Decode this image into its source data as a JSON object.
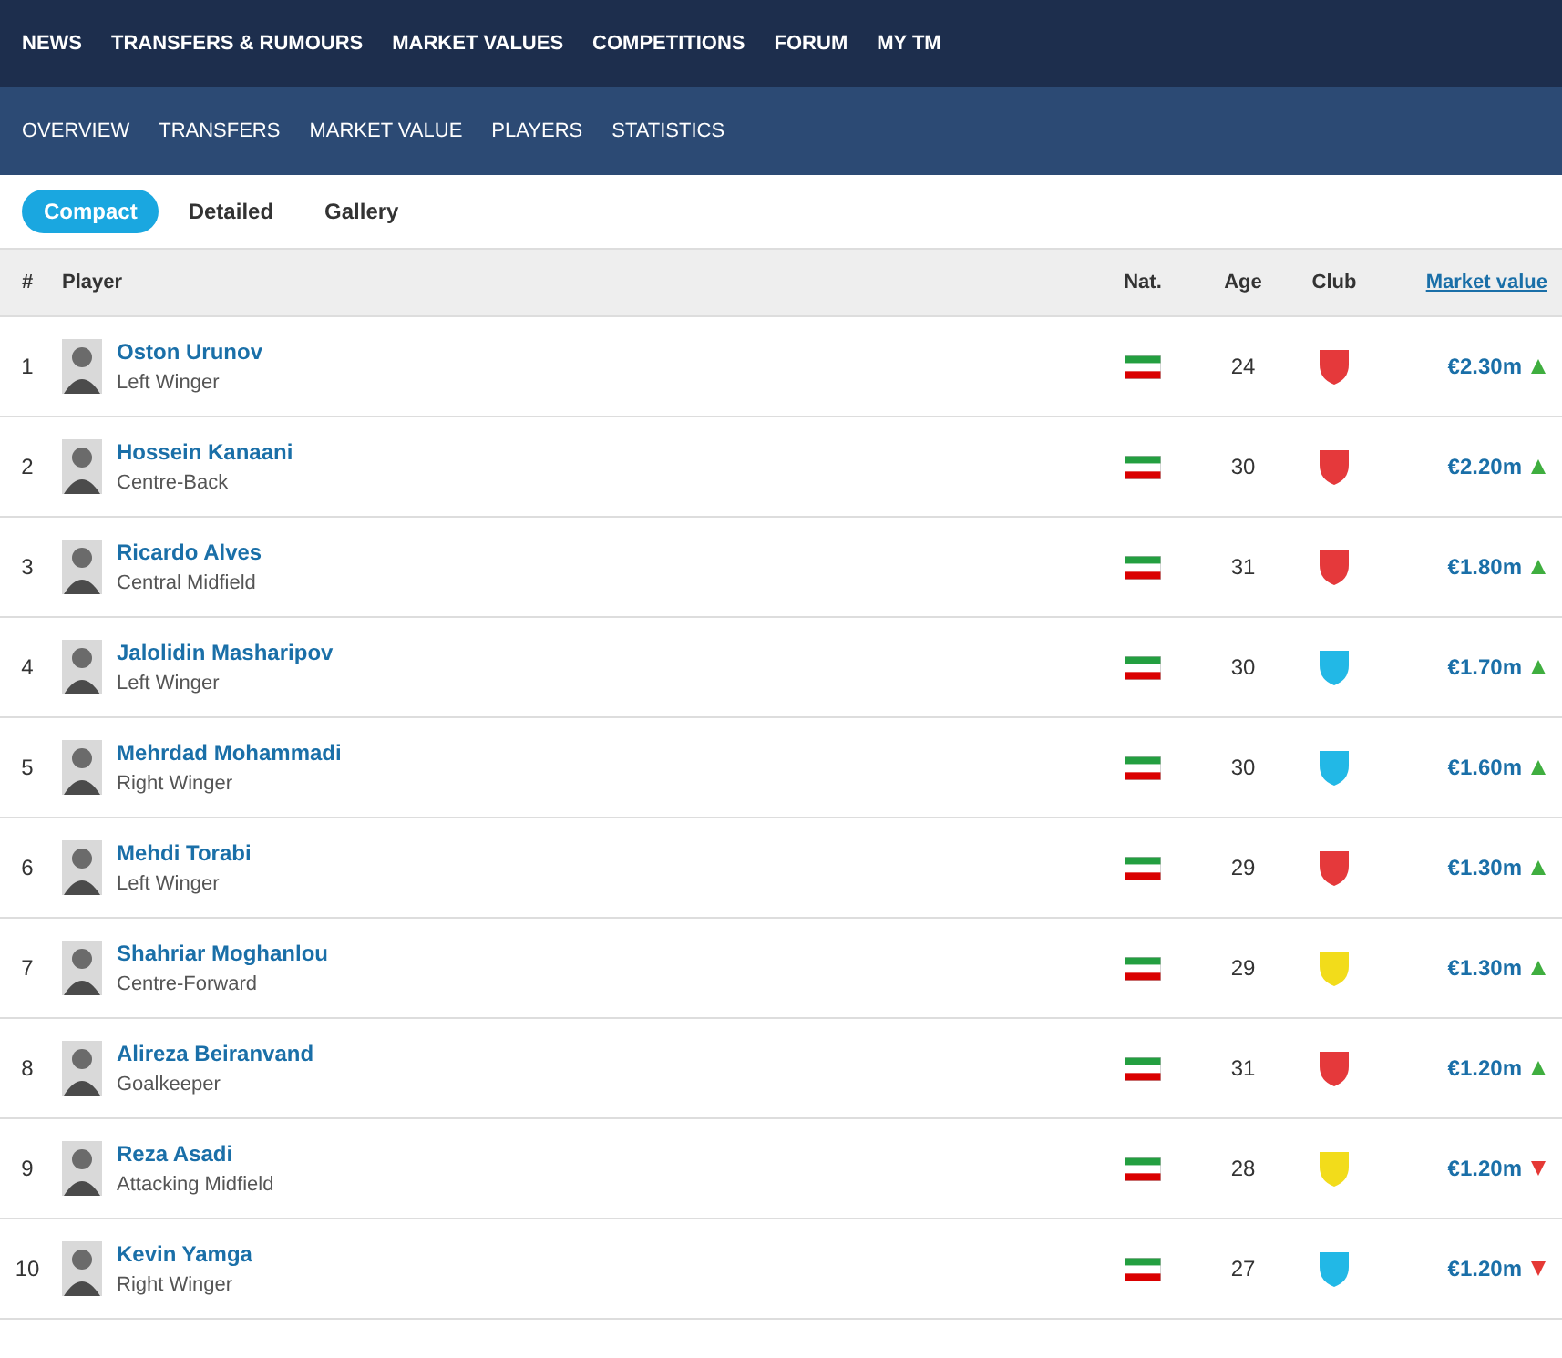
{
  "panels": [
    {
      "nav": [
        "NEWS",
        "TRANSFERS & RUMOURS",
        "MARKET VALUES",
        "COMPETITIONS",
        "FORUM",
        "MY TM"
      ],
      "subnav": [
        "OVERVIEW",
        "TRANSFERS",
        "MARKET VALUE",
        "PLAYERS",
        "STATISTICS"
      ],
      "tabs": [
        {
          "label": "Compact",
          "selected": true
        },
        {
          "label": "Detailed",
          "selected": false
        },
        {
          "label": "Gallery",
          "selected": false
        }
      ],
      "columns": [
        "#",
        "Player",
        "Nat.",
        "Age",
        "Club",
        "Market value"
      ],
      "rows": [
        {
          "rank": "1",
          "name": "Oston Urunov",
          "position": "Left Winger",
          "age": "24",
          "value": "€2.30m",
          "color": "#e5393b",
          "rising": true
        },
        {
          "rank": "2",
          "name": "Hossein Kanaani",
          "position": "Centre-Back",
          "age": "30",
          "value": "€2.20m",
          "color": "#e5393b",
          "rising": true
        },
        {
          "rank": "3",
          "name": "Ricardo Alves",
          "position": "Central Midfield",
          "age": "31",
          "value": "€1.80m",
          "color": "#e5393b",
          "rising": true
        },
        {
          "rank": "4",
          "name": "Jalolidin Masharipov",
          "position": "Left Winger",
          "age": "30",
          "value": "€1.70m",
          "color": "#22b8e6",
          "rising": true
        },
        {
          "rank": "5",
          "name": "Mehrdad Mohammadi",
          "position": "Right Winger",
          "age": "30",
          "value": "€1.60m",
          "color": "#22b8e6",
          "rising": true
        },
        {
          "rank": "6",
          "name": "Mehdi Torabi",
          "position": "Left Winger",
          "age": "29",
          "value": "€1.30m",
          "color": "#e5393b",
          "rising": true
        },
        {
          "rank": "7",
          "name": "Shahriar Moghanlou",
          "position": "Centre-Forward",
          "age": "29",
          "value": "€1.30m",
          "color": "#f2dc1b",
          "rising": true
        },
        {
          "rank": "8",
          "name": "Alireza Beiranvand",
          "position": "Goalkeeper",
          "age": "31",
          "value": "€1.20m",
          "color": "#e5393b",
          "rising": true
        },
        {
          "rank": "9",
          "name": "Reza Asadi",
          "position": "Attacking Midfield",
          "age": "28",
          "value": "€1.20m",
          "color": "#f2dc1b",
          "rising": false
        },
        {
          "rank": "10",
          "name": "Kevin Yamga",
          "position": "Right Winger",
          "age": "27",
          "value": "€1.20m",
          "color": "#22b8e6",
          "rising": false
        }
      ]
    }
  ]
}
